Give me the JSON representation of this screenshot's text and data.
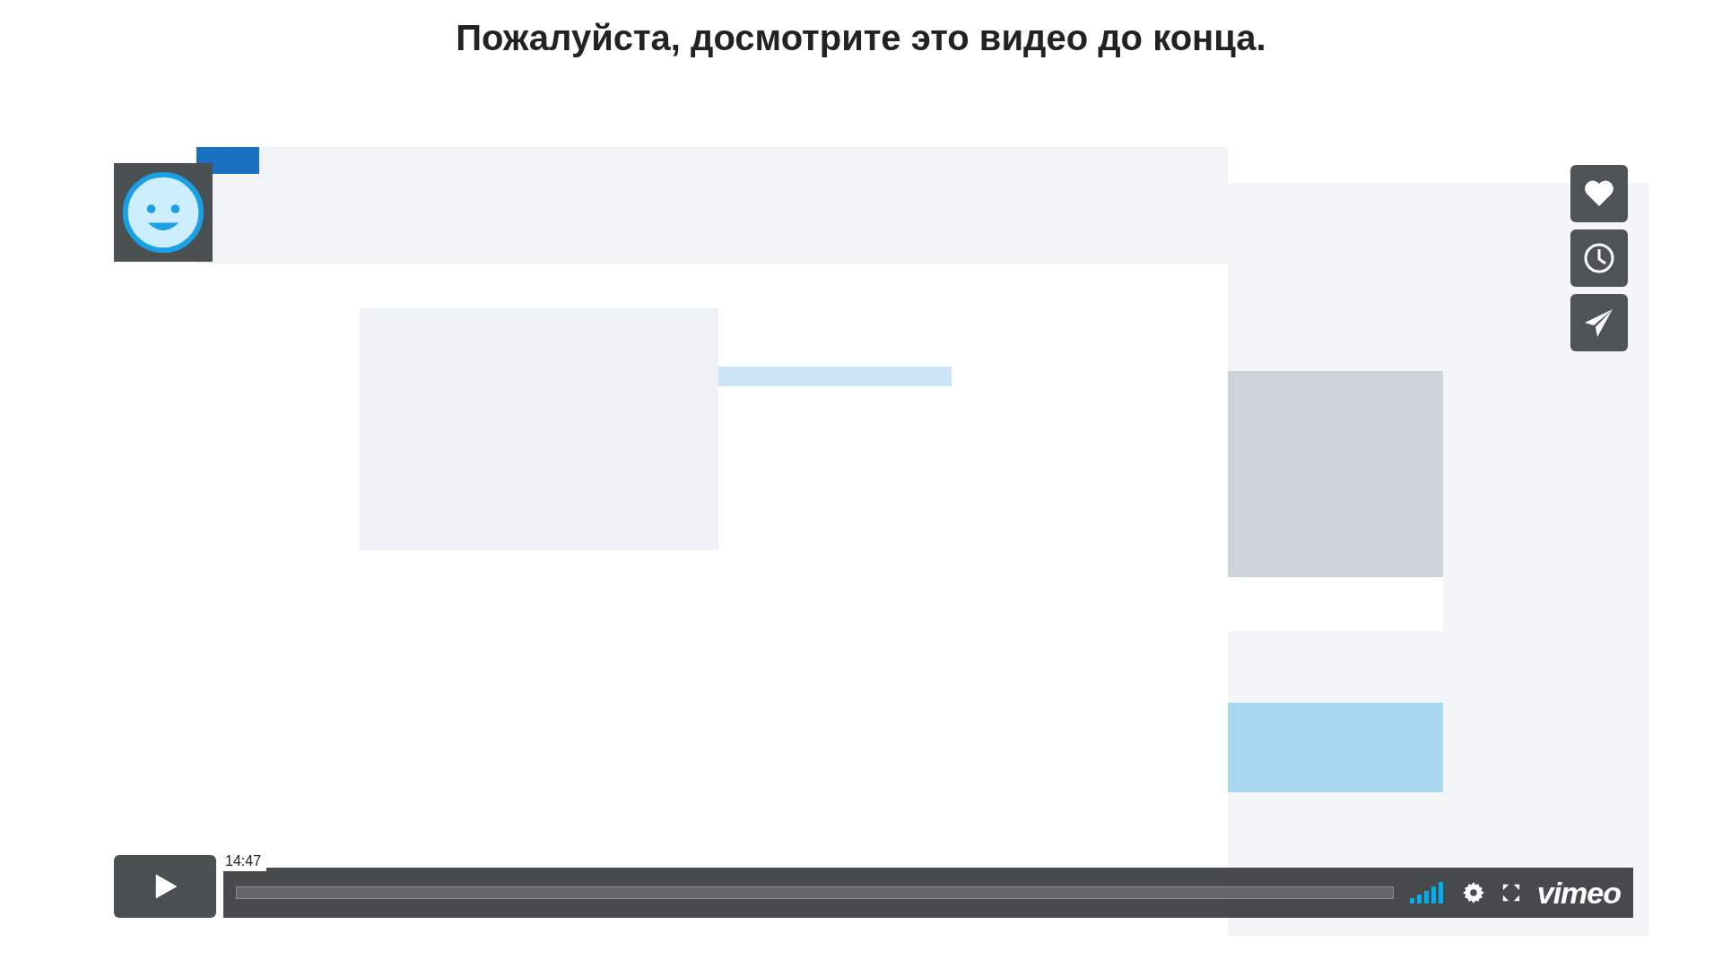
{
  "heading": "Пожалуйста, досмотрите это видео до конца.",
  "player": {
    "kind": "picture",
    "time": "14:47",
    "brand": "vimeo"
  }
}
